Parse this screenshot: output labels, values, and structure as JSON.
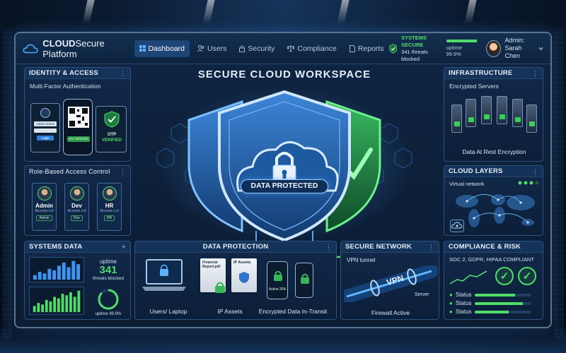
{
  "app": {
    "logo_bold": "CLOUD",
    "logo_rest": "Secure Platform",
    "nav": [
      {
        "label": "Dashboard",
        "icon": "grid-icon",
        "active": true
      },
      {
        "label": "Users",
        "icon": "users-icon",
        "active": false
      },
      {
        "label": "Security",
        "icon": "lock-icon",
        "active": false
      },
      {
        "label": "Compliance",
        "icon": "scales-icon",
        "active": false
      },
      {
        "label": "Reports",
        "icon": "document-icon",
        "active": false
      }
    ],
    "status_title": "SYSTEMS SECURE",
    "threats_line": "341 threats blocked",
    "uptime_label": "uptime 99.9%",
    "uptime_fraction": 0.999,
    "admin_label": "Admin:",
    "admin_name": "Sarah Chen"
  },
  "identity": {
    "title": "IDENTITY & ACCESS",
    "subtitle": "Multi-Factor Authentication",
    "login_field": "Admin Name",
    "login_button": "Login",
    "phone_badge": "2FA VERIFIED",
    "otp_line1": "OTP",
    "otp_line2": "VERIFIED"
  },
  "rbac": {
    "title": "Role-Based Access Control",
    "roles": [
      {
        "name": "Admin",
        "sub": "Access Lvl",
        "chip": "Admin"
      },
      {
        "name": "Dev",
        "sub": "Access Lvl",
        "chip": "Dev"
      },
      {
        "name": "HR",
        "sub": "Access Lvl",
        "chip": "HR"
      }
    ]
  },
  "systems": {
    "title": "SYSTEMS DATA",
    "uptime_word": "uptime",
    "threat_count": "341",
    "threat_label": "threats blocked",
    "uptime_label": "uptime 99.9%",
    "chart_top": [
      3,
      5,
      4,
      7,
      6,
      9,
      11,
      8,
      12,
      10
    ],
    "chart_bottom": [
      4,
      6,
      5,
      8,
      7,
      10,
      9,
      12,
      11,
      13,
      10,
      14
    ]
  },
  "center": {
    "title": "SECURE CLOUD WORKSPACE",
    "badge": "DATA PROTECTED"
  },
  "protection": {
    "title": "DATA PROTECTION",
    "doc1": "Financial Report.pdf",
    "doc2": "IP Assets",
    "phone_label": "Active 2FA",
    "cap_laptop": "Users/ Laptop",
    "cap_assets": "IP Assets",
    "cap_transit": "Encrypted Data In-Transit"
  },
  "network": {
    "title": "SECURE NETWORK",
    "vpn_tunnel": "VPN tunnel",
    "vpn": "VPN",
    "server": "Server",
    "firewall": "Firewall Active"
  },
  "infrastructure": {
    "title": "INFRASTRUCTURE",
    "subtitle": "Encrypted Servers",
    "caption": "Data At Rest Encryption"
  },
  "cloud_layers": {
    "title": "CLOUD LAYERS",
    "subtitle": "Virtual network"
  },
  "compliance": {
    "title": "COMPLIANCE & RISK",
    "subtitle": "SOC 2, GDPR, HIPAA COMPLIANT",
    "stats": [
      {
        "label": "Status",
        "fraction": 0.72
      },
      {
        "label": "Status",
        "fraction": 0.85
      },
      {
        "label": "Status",
        "fraction": 0.6
      }
    ]
  },
  "colors": {
    "accent": "#4fdc6a",
    "brand": "#3b8fe0",
    "shield": "#2f72c8"
  }
}
